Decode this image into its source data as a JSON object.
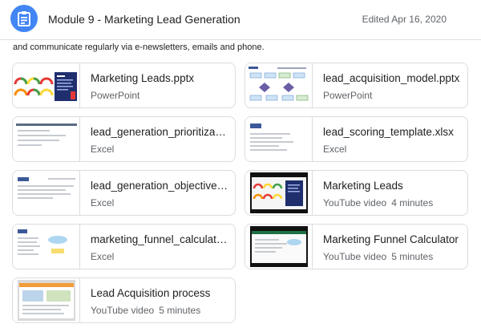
{
  "header": {
    "title": "Module 9 - Marketing Lead Generation",
    "edited": "Edited Apr 16, 2020",
    "icon": "assignment-icon",
    "accent": "#4285f4"
  },
  "description": "and communicate regularly via e-newsletters, emails and phone.",
  "attachments": [
    {
      "title": "Marketing Leads.pptx",
      "type": "PowerPoint",
      "duration": "",
      "thumb": "slides-gauges"
    },
    {
      "title": "lead_acquisition_model.pptx",
      "type": "PowerPoint",
      "duration": "",
      "thumb": "slides-diagram"
    },
    {
      "title": "lead_generation_prioritization.xlsx",
      "type": "Excel",
      "duration": "",
      "thumb": "sheet"
    },
    {
      "title": "lead_scoring_template.xlsx",
      "type": "Excel",
      "duration": "",
      "thumb": "sheet"
    },
    {
      "title": "lead_generation_objectives.xlsx",
      "type": "Excel",
      "duration": "",
      "thumb": "sheet"
    },
    {
      "title": "Marketing Leads",
      "type": "YouTube video",
      "duration": "4 minutes",
      "thumb": "video-gauges"
    },
    {
      "title": "marketing_funnel_calculator.xlsx",
      "type": "Excel",
      "duration": "",
      "thumb": "sheet-chart"
    },
    {
      "title": "Marketing Funnel Calculator",
      "type": "YouTube video",
      "duration": "5 minutes",
      "thumb": "video-sheet"
    },
    {
      "title": "Lead Acquisition process",
      "type": "YouTube video",
      "duration": "5 minutes",
      "thumb": "video-site"
    }
  ]
}
